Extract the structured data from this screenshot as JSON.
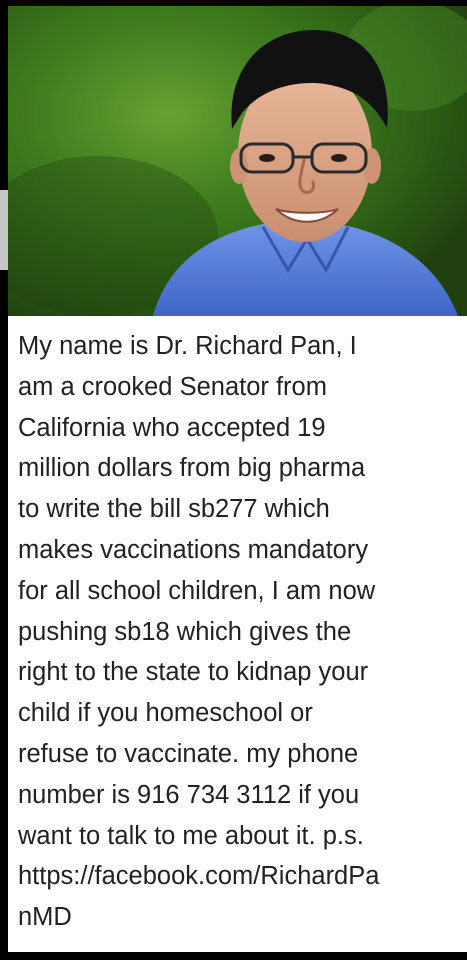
{
  "colors": {
    "background": "#000000",
    "text": "#222222",
    "panel": "#ffffff",
    "shirt": "#4f7bd8",
    "grass": "#3f7a1f"
  },
  "photo": {
    "subject": "portrait-photo"
  },
  "caption": {
    "lines": [
      "My name is Dr. Richard Pan, I",
      "am a crooked Senator from",
      "California who accepted 19",
      "million dollars from big pharma",
      "to write the bill sb277 which",
      "makes vaccinations mandatory",
      "for all school children, I am now",
      "pushing sb18 which gives the",
      "right to the state to kidnap your",
      "child if you homeschool or",
      "refuse to vaccinate. my phone",
      "number is 916 734 3112 if you",
      "want to talk to me about it. p.s.",
      "https://facebook.com/RichardPa",
      "nMD"
    ]
  }
}
